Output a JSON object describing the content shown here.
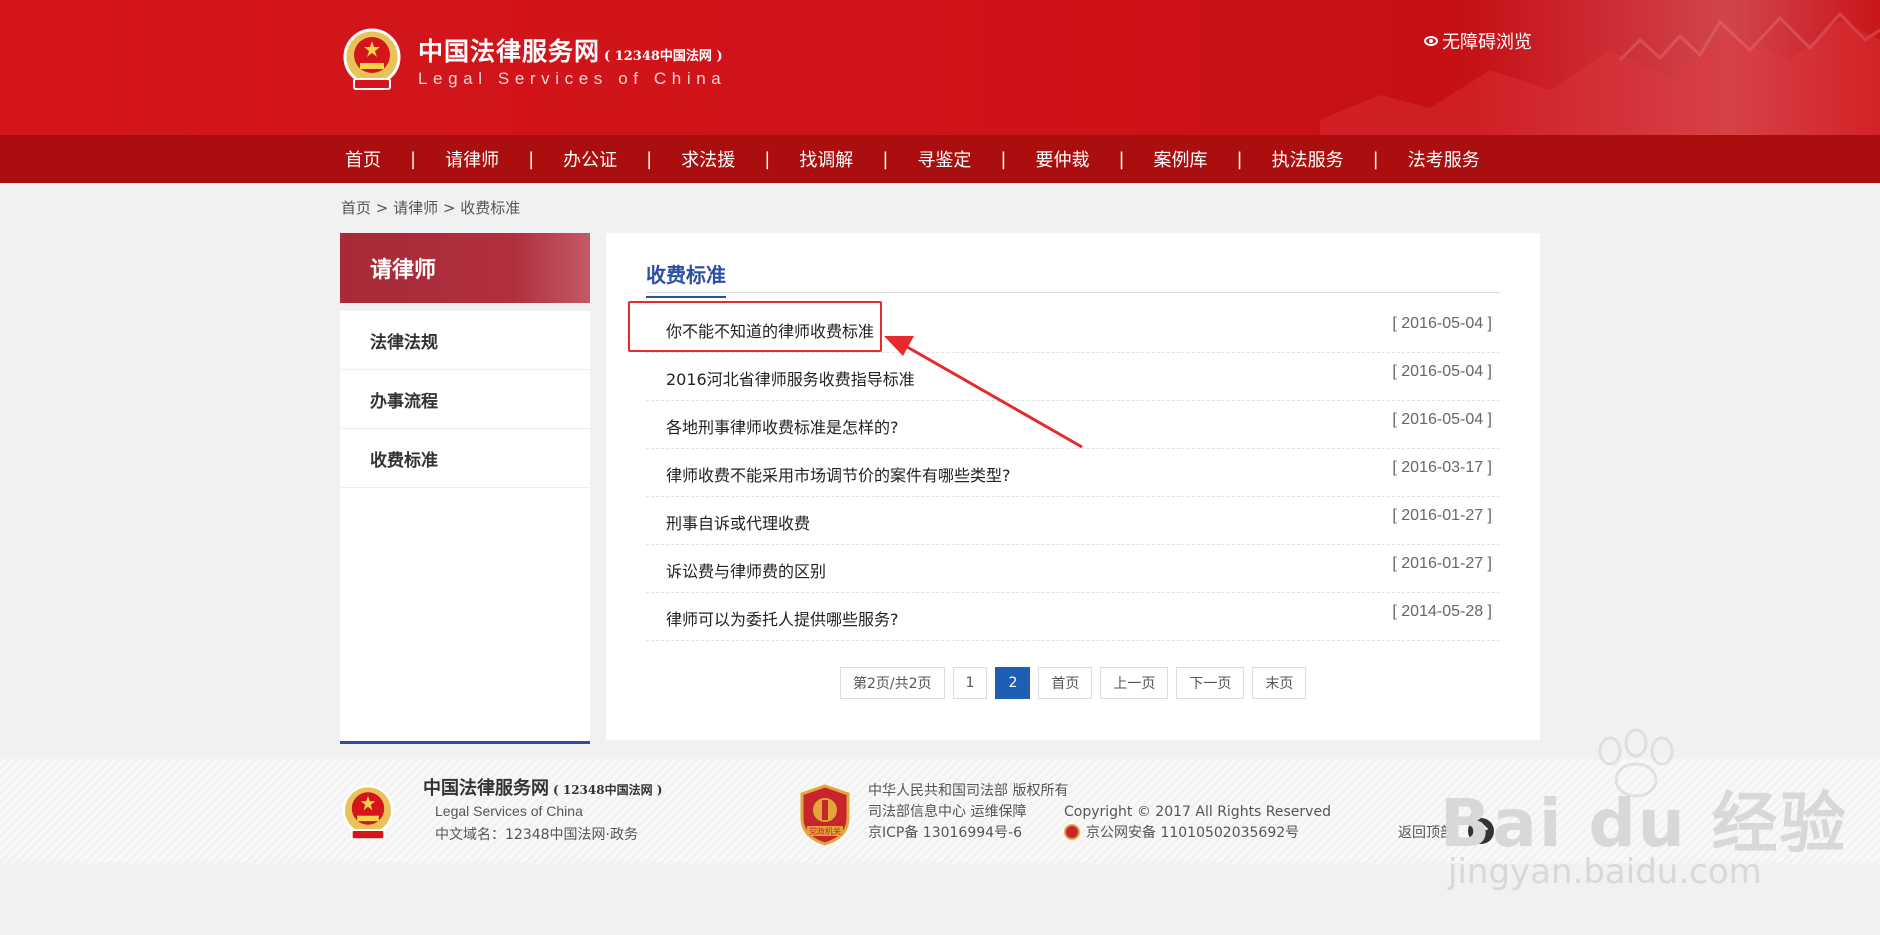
{
  "header": {
    "title": "中国法律服务网",
    "title_suffix": "( 12348中国法网 )",
    "subtitle": "Legal Services of China",
    "accessibility": "无障碍浏览"
  },
  "nav": {
    "items": [
      "首页",
      "请律师",
      "办公证",
      "求法援",
      "找调解",
      "寻鉴定",
      "要仲裁",
      "案例库",
      "执法服务",
      "法考服务"
    ],
    "separator": "|"
  },
  "breadcrumb": "首页 > 请律师 > 收费标准",
  "sidebar": {
    "heading": "请律师",
    "items": [
      "法律法规",
      "办事流程",
      "收费标准"
    ]
  },
  "main": {
    "title": "收费标准",
    "articles": [
      {
        "title": "你不能不知道的律师收费标准",
        "date": "[ 2016-05-04 ]"
      },
      {
        "title": "2016河北省律师服务收费指导标准",
        "date": "[ 2016-05-04 ]"
      },
      {
        "title": "各地刑事律师收费标准是怎样的?",
        "date": "[ 2016-05-04 ]"
      },
      {
        "title": "律师收费不能采用市场调节价的案件有哪些类型?",
        "date": "[ 2016-03-17 ]"
      },
      {
        "title": "刑事自诉或代理收费",
        "date": "[ 2016-01-27 ]"
      },
      {
        "title": "诉讼费与律师费的区别",
        "date": "[ 2016-01-27 ]"
      },
      {
        "title": "律师可以为委托人提供哪些服务?",
        "date": "[ 2014-05-28 ]"
      }
    ],
    "pager": {
      "info": "第2页/共2页",
      "pages": [
        "1",
        "2"
      ],
      "current": "2",
      "first": "首页",
      "prev": "上一页",
      "next": "下一页",
      "last": "末页"
    }
  },
  "footer": {
    "title": "中国法律服务网",
    "title_suffix": "( 12348中国法网 )",
    "subtitle": "Legal Services of China",
    "domain": "中文域名：12348中国法网·政务",
    "badge_text": "党政机关",
    "copyright_owner": "中华人民共和国司法部 版权所有",
    "support": "司法部信息中心 运维保障",
    "icp": "京ICP备 13016994号-6",
    "rights": "Copyright © 2017 All Rights Reserved",
    "police": "京公网安备 11010502035692号",
    "back_top": "返回顶部"
  },
  "watermark": {
    "brand": "Bai du 经验",
    "url": "jingyan.baidu.com"
  },
  "colors": {
    "header_red": "#d4161c",
    "nav_red": "#ab0e0e",
    "accent_blue": "#2c4fa3",
    "pager_active": "#1e5fb4",
    "highlight": "#e52b2b"
  }
}
